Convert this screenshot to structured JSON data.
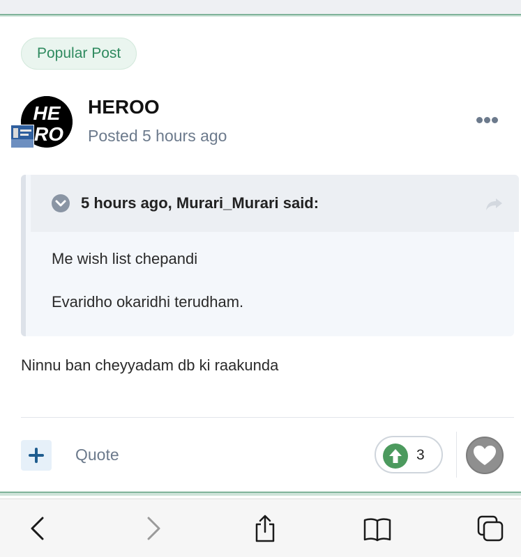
{
  "post": {
    "badge": "Popular Post",
    "author": "HEROO",
    "posted": "Posted 5 hours ago",
    "avatar_text_top": "HE",
    "avatar_text_bottom": "RO",
    "more_icon": "ellipsis-icon"
  },
  "quote": {
    "title": "5 hours ago, Murari_Murari said:",
    "line1": "Me wish list chepandi",
    "line2": "Evaridho okaridhi terudham.",
    "collapse_icon": "chevron-down-icon",
    "share_icon": "share-arrow-icon"
  },
  "content": {
    "text": "Ninnu ban cheyyadam db ki raakunda"
  },
  "actions": {
    "quote_label": "Quote",
    "reaction_count": "3",
    "plus_icon": "plus-icon",
    "reaction_icon": "upvote-arrow-icon",
    "react_icon": "heart-icon"
  },
  "browser_toolbar": {
    "items": [
      "back-icon",
      "forward-icon",
      "share-icon",
      "bookmarks-icon",
      "tabs-icon"
    ]
  },
  "colors": {
    "accent_green": "#2f8a5f",
    "badge_bg": "#eaf5ef",
    "upvote_green": "#4c9a5e",
    "muted_text": "#6c7a8c",
    "quote_bg": "#f4f7fb"
  }
}
